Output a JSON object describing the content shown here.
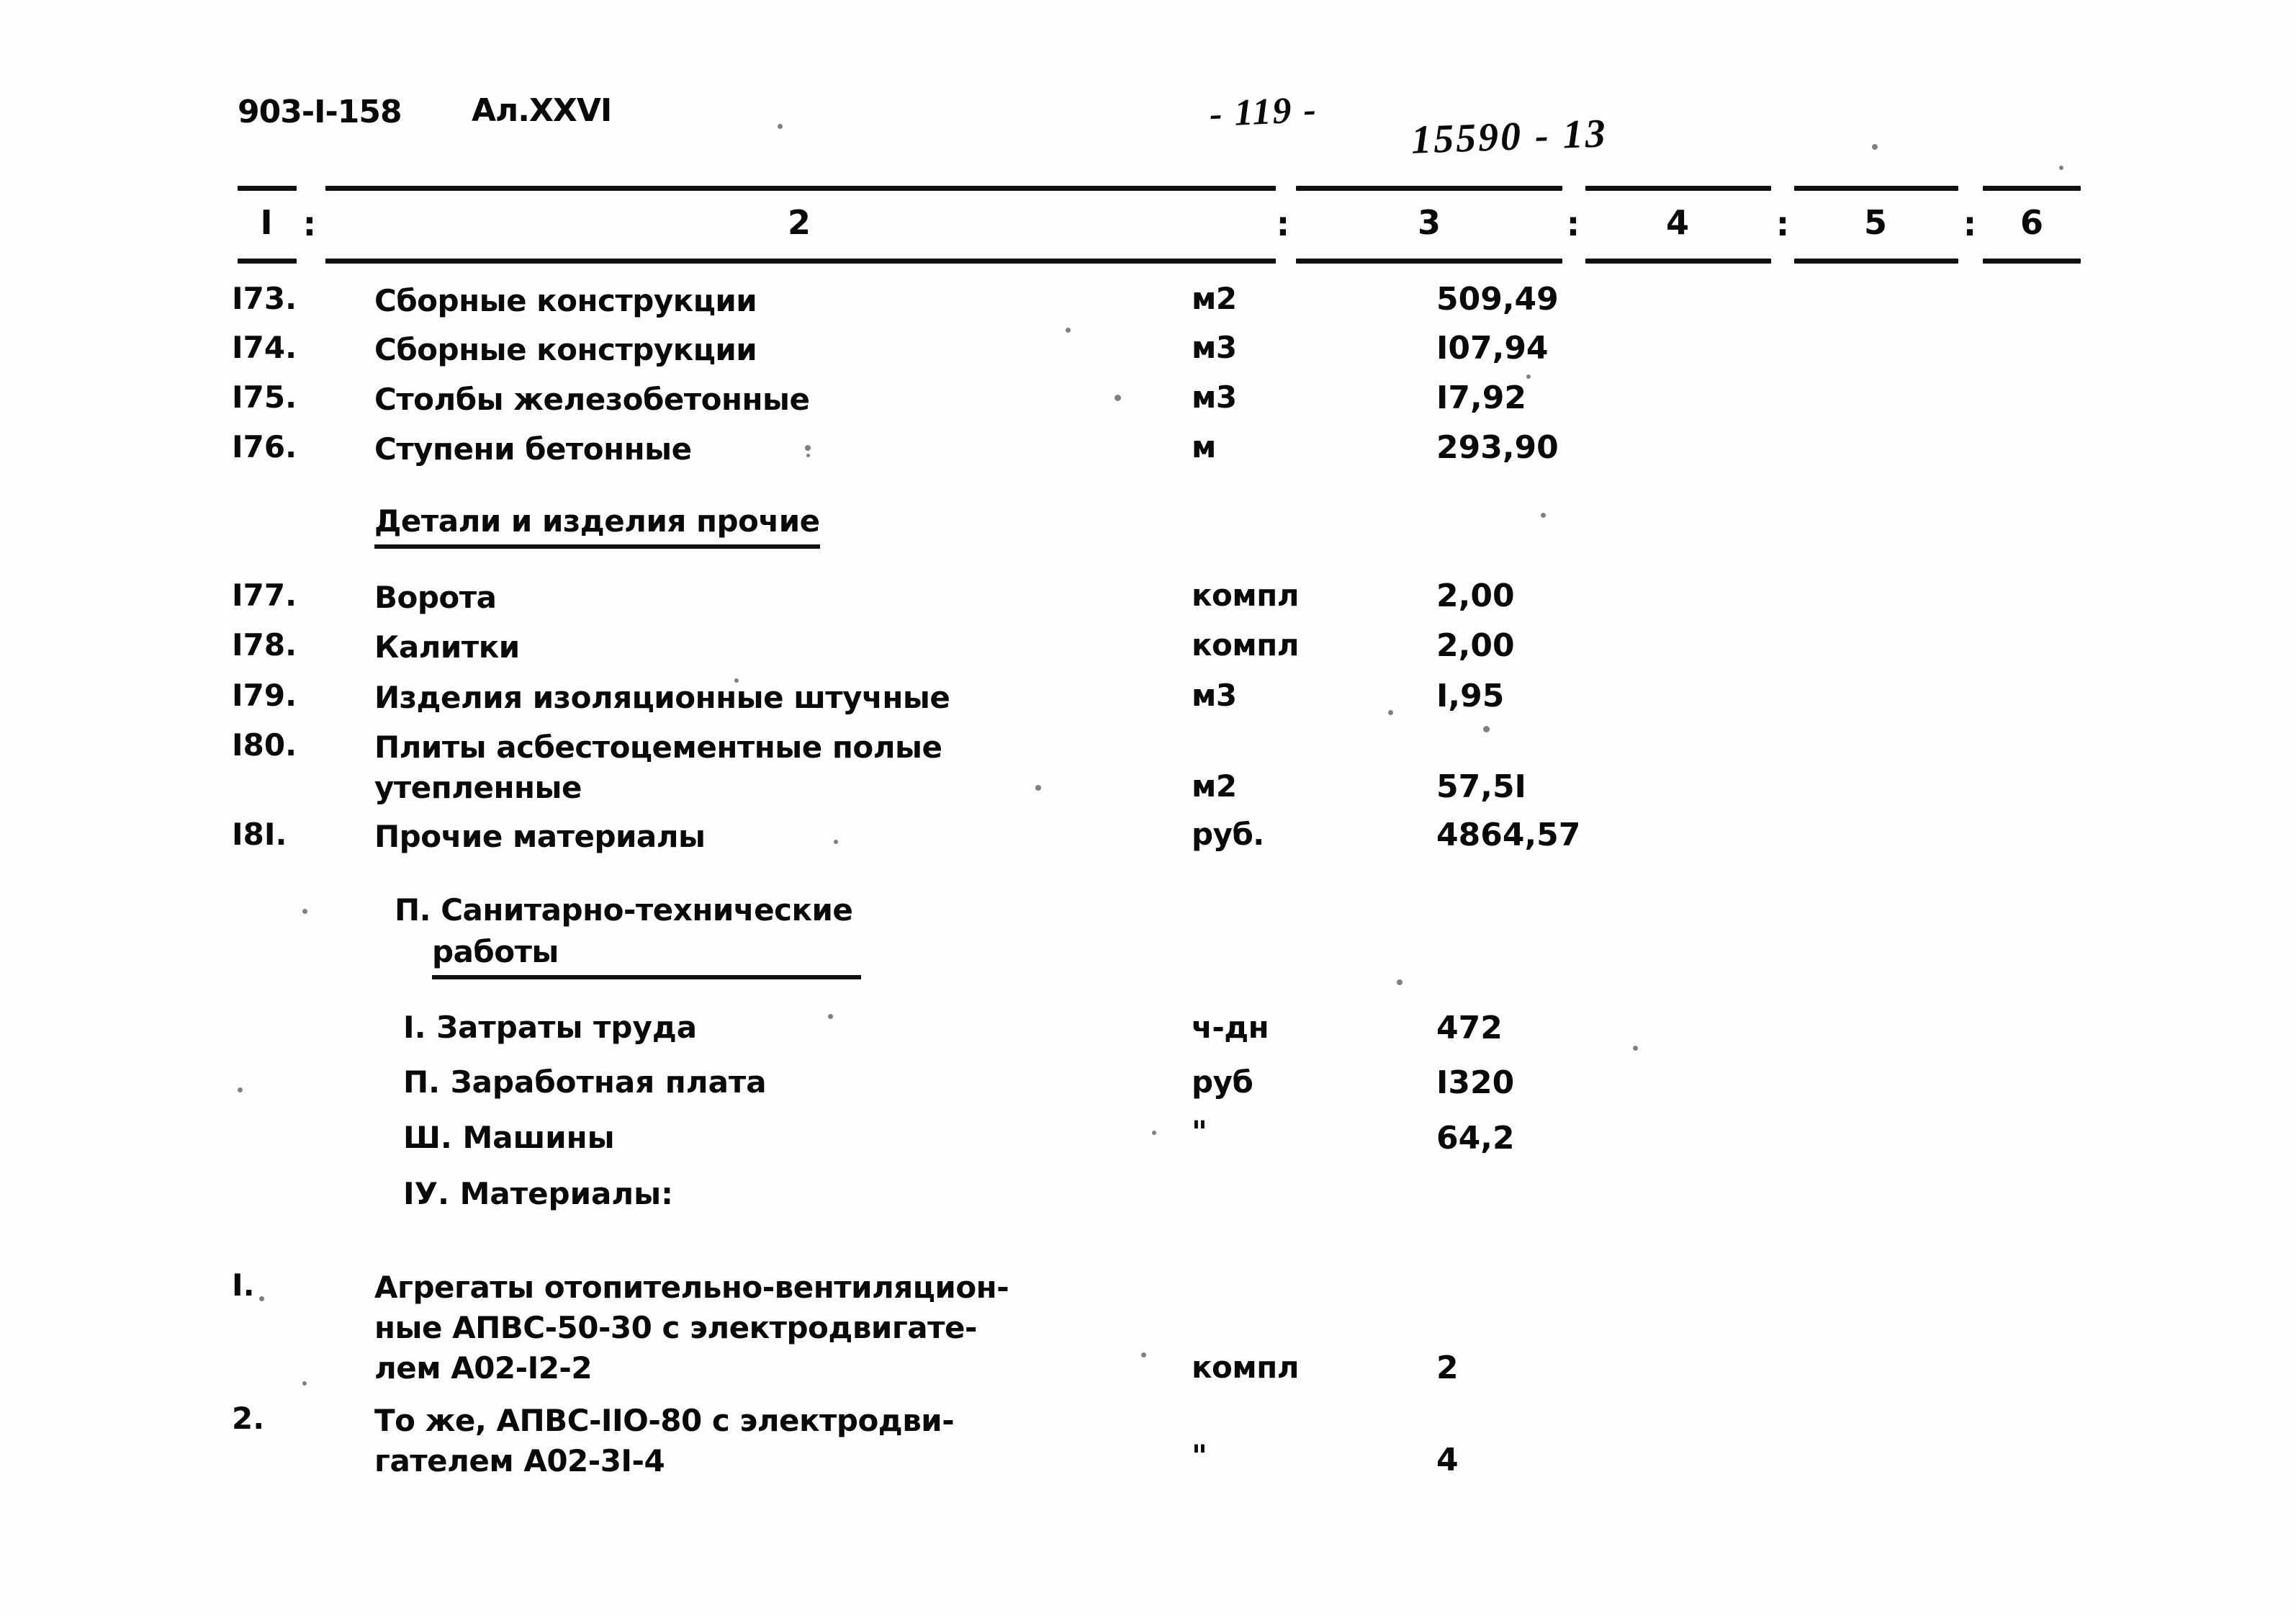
{
  "header": {
    "doc_code": "903-I-158",
    "album": "Ал.XXVI",
    "page_number": "- 119 -",
    "archive_stamp": "15590 - 13"
  },
  "columns": {
    "numbers": [
      "I",
      "2",
      "3",
      "4",
      "5",
      "6"
    ],
    "separator": ":"
  },
  "rows": [
    {
      "no": "I73.",
      "name": "Сборные конструкции",
      "unit": "м2",
      "qty": "509,49"
    },
    {
      "no": "I74.",
      "name": "Сборные конструкции",
      "unit": "м3",
      "qty": "I07,94"
    },
    {
      "no": "I75.",
      "name": "Столбы железобетонные",
      "unit": "м3",
      "qty": "I7,92"
    },
    {
      "no": "I76.",
      "name": "Ступени бетонные",
      "unit": "м",
      "qty": "293,90"
    },
    {
      "no": "I77.",
      "name": "Ворота",
      "unit": "компл",
      "qty": "2,00"
    },
    {
      "no": "I78.",
      "name": "Калитки",
      "unit": "компл",
      "qty": "2,00"
    },
    {
      "no": "I79.",
      "name": "Изделия изоляционные штучные",
      "unit": "м3",
      "qty": "I,95"
    },
    {
      "no": "I80.",
      "name": "Плиты асбестоцементные полые\nутепленные",
      "unit": "м2",
      "qty": "57,5I"
    },
    {
      "no": "I8I.",
      "name": "Прочие материалы",
      "unit": "руб.",
      "qty": "4864,57"
    }
  ],
  "section_details": {
    "title": "Детали и изделия прочие"
  },
  "section_sanitary": {
    "line1": "П. Санитарно-технические",
    "line2": "работы"
  },
  "sanitary_items": [
    {
      "label": "I. Затраты труда",
      "unit": "ч-дн",
      "qty": "472"
    },
    {
      "label": "П. Заработная плата",
      "unit": "руб",
      "qty": "I320"
    },
    {
      "label": "Ш. Машины",
      "unit": "\"",
      "qty": "64,2"
    },
    {
      "label": "IУ. Материалы:",
      "unit": "",
      "qty": ""
    }
  ],
  "materials": [
    {
      "no": "I.",
      "name": "Агрегаты отопительно-вентиляцион-\nные АПВС-50-30 с электродвигате-\nлем А02-I2-2",
      "unit": "компл",
      "qty": "2"
    },
    {
      "no": "2.",
      "name": "То же, АПВС-IIО-80 с электродви-\nгателем А02-3I-4",
      "unit": "\"",
      "qty": "4"
    }
  ]
}
